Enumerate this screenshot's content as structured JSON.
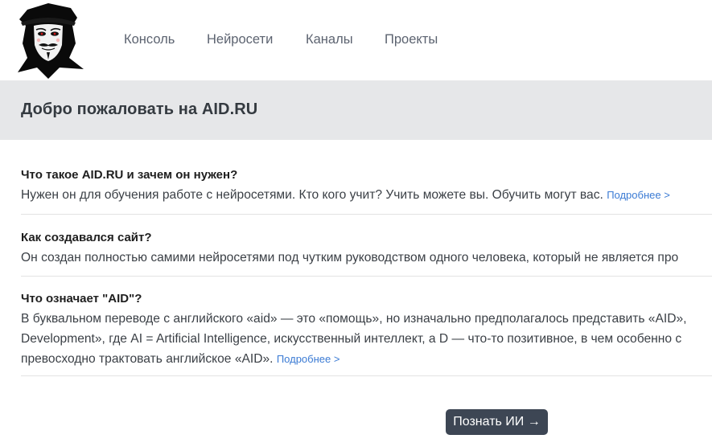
{
  "nav": {
    "items": [
      {
        "label": "Консоль"
      },
      {
        "label": "Нейросети"
      },
      {
        "label": "Каналы"
      },
      {
        "label": "Проекты"
      }
    ]
  },
  "banner": {
    "title": "Добро пожаловать на AID.RU"
  },
  "faq": [
    {
      "question": "Что такое AID.RU и зачем он нужен?",
      "answer_lines": [
        "Нужен он для обучения работе с нейросетями. Кто кого учит? Учить можете вы. Обучить могут вас. "
      ],
      "more": "Подробнее >"
    },
    {
      "question": "Как создавался сайт?",
      "answer_lines": [
        "Он создан полностью самими нейросетями под чутким руководством одного человека, который не является про"
      ]
    },
    {
      "question": "Что означает \"AID\"?",
      "answer_lines": [
        "В буквальном переводе с английского «aid» — это «помощь», но изначально предполагалось представить «AID»,",
        "Development», где AI = Artificial Intelligence, искусственный интеллект, а D — что-то позитивное, в чем особенно с",
        "превосходно трактовать английское «AID». "
      ],
      "more": "Подробнее >"
    }
  ],
  "cta": {
    "label": "Познать ИИ →"
  },
  "colors": {
    "nav_text": "#5c6370",
    "banner_bg": "#e6e7e9",
    "link": "#3b7bd4",
    "button_bg": "#3d4654"
  }
}
